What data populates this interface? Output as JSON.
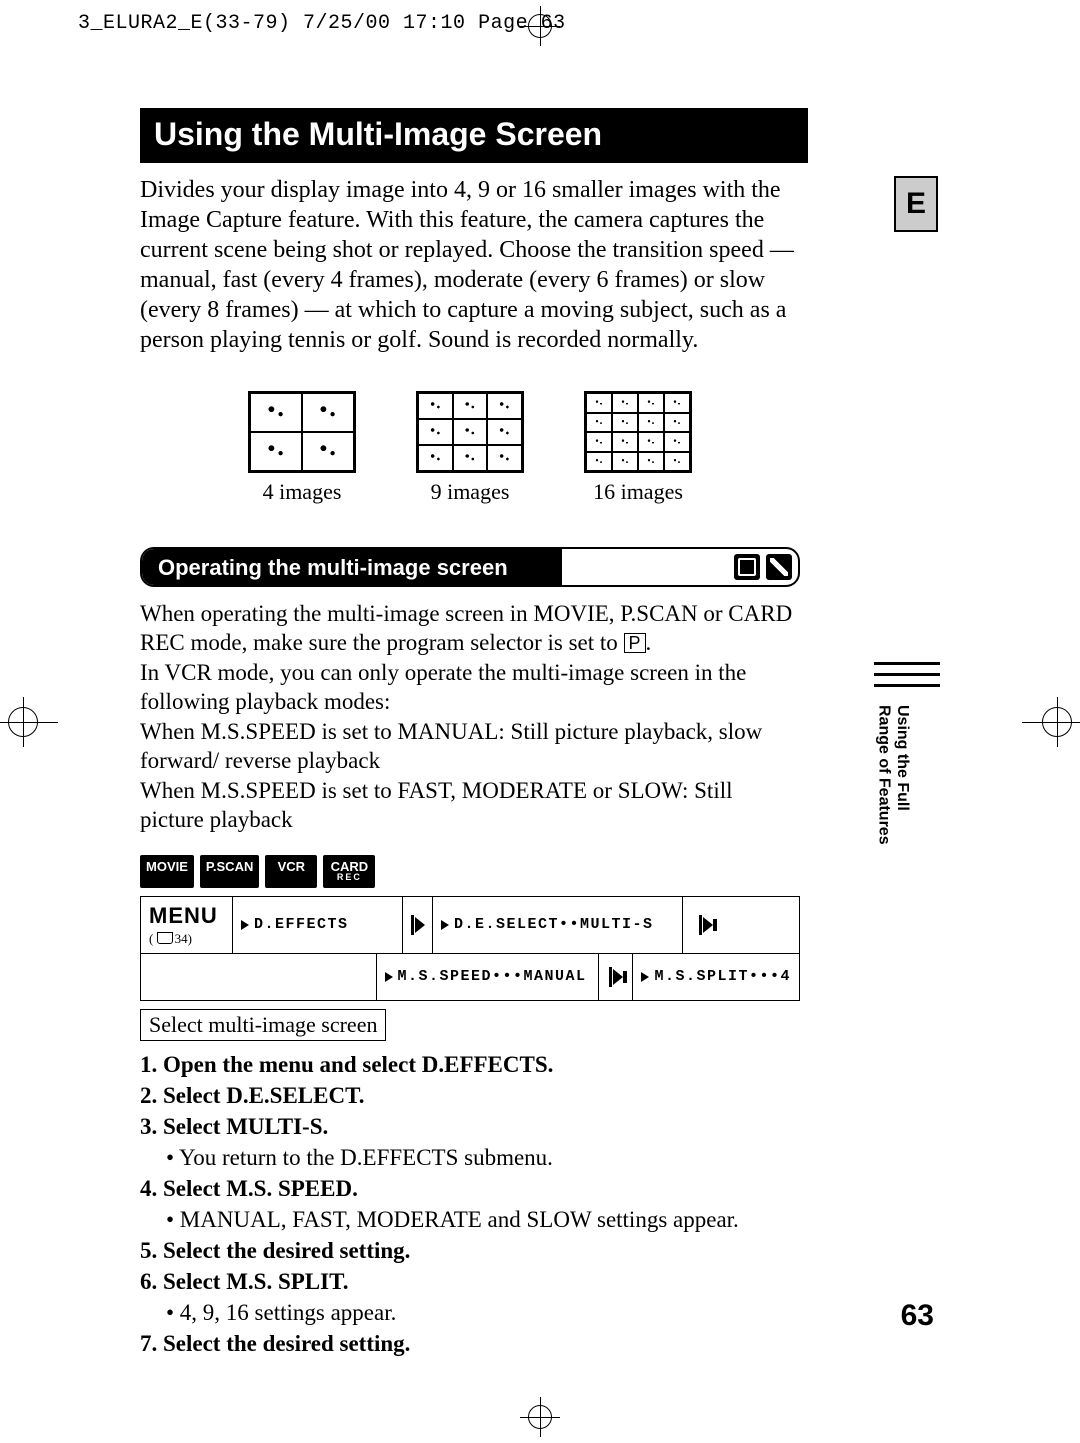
{
  "print_header": "3_ELURA2_E(33-79)  7/25/00 17:10  Page 63",
  "lang_badge": "E",
  "title": "Using the Multi-Image Screen",
  "intro": "Divides your display image into 4, 9 or 16 smaller images with the Image Capture feature. With this feature, the camera captures the current scene being shot or replayed. Choose the transition speed — manual, fast (every 4 frames), moderate (every 6 frames) or slow (every 8 frames) — at which to capture a moving subject, such as a person playing tennis or golf. Sound is recorded normally.",
  "grid_labels": {
    "g4": "4 images",
    "g9": "9 images",
    "g16": "16 images"
  },
  "subheader": "Operating the multi-image screen",
  "operating": {
    "p1a": "When operating the multi-image screen in MOVIE, P.SCAN or CARD REC mode, make sure the program selector is set to ",
    "p1b": ".",
    "p2": "In VCR mode, you can only operate the multi-image screen in the following playback modes:",
    "p3": "When M.S.SPEED is set to MANUAL: Still picture playback, slow forward/ reverse playback",
    "p4": "When M.S.SPEED is set to FAST, MODERATE or SLOW: Still picture playback",
    "p_icon": "P"
  },
  "modes": [
    "MOVIE",
    "P.SCAN",
    "VCR"
  ],
  "mode_card": {
    "top": "CARD",
    "bottom": "REC"
  },
  "menu": {
    "label": "MENU",
    "ref": "34",
    "row1": {
      "c1": "D.EFFECTS",
      "c2": "D.E.SELECT••MULTI-S"
    },
    "row2": {
      "c1": "M.S.SPEED•••MANUAL",
      "c2": "M.S.SPLIT•••4"
    }
  },
  "caption": "Select multi-image screen",
  "steps": {
    "s1": "1. Open the menu and select D.EFFECTS.",
    "s2": "2. Select D.E.SELECT.",
    "s3": "3. Select MULTI-S.",
    "s3b": "• You return to the D.EFFECTS submenu.",
    "s4": "4. Select M.S. SPEED.",
    "s4b": "• MANUAL, FAST, MODERATE and SLOW settings appear.",
    "s5": "5. Select the desired setting.",
    "s6": "6. Select M.S. SPLIT.",
    "s6b": "• 4, 9, 16 settings appear.",
    "s7": "7. Select the desired setting."
  },
  "side_tab": {
    "line1": "Using the Full",
    "line2": "Range of Features"
  },
  "page_number": "63"
}
